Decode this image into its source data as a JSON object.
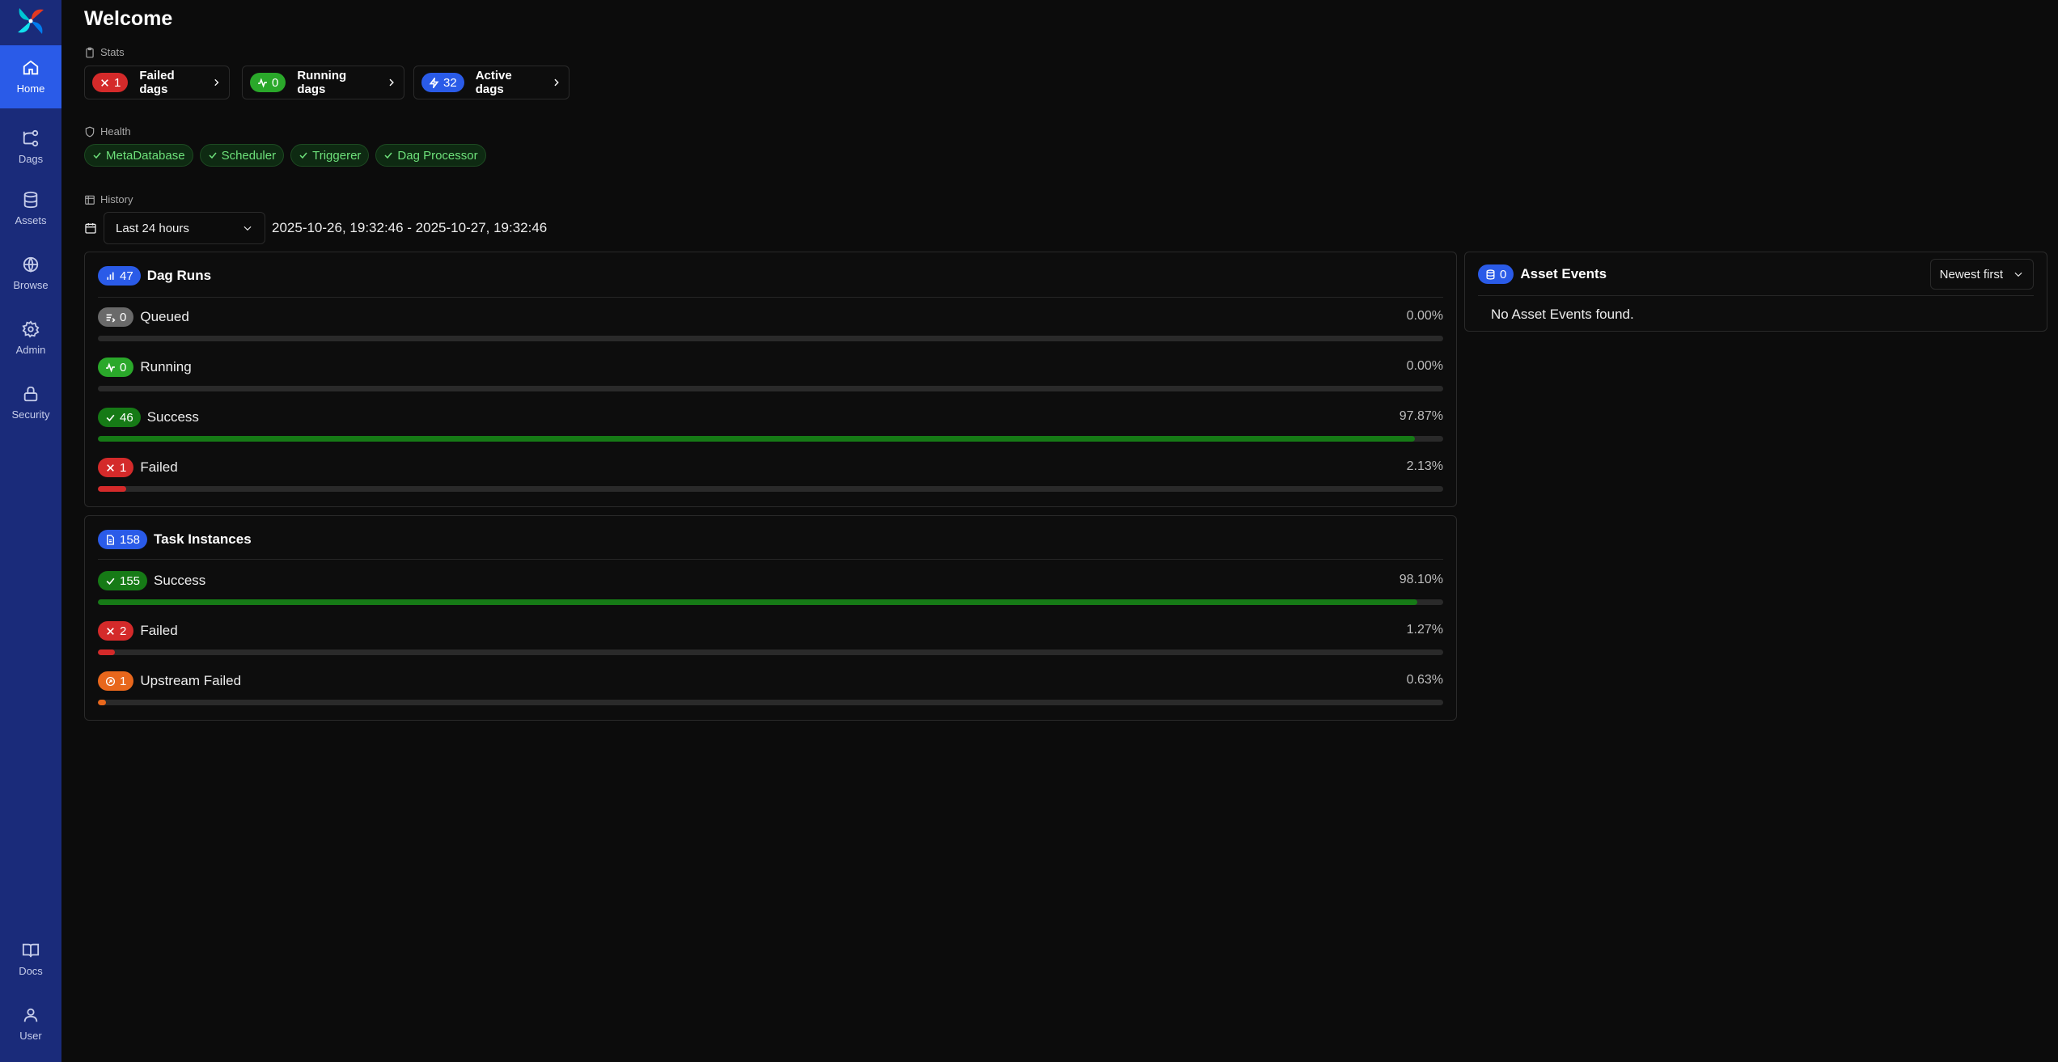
{
  "sidebar": {
    "items": [
      {
        "label": "Home",
        "icon": "home-icon",
        "active": true
      },
      {
        "label": "Dags",
        "icon": "dags-icon"
      },
      {
        "label": "Assets",
        "icon": "database-icon"
      },
      {
        "label": "Browse",
        "icon": "globe-icon"
      },
      {
        "label": "Admin",
        "icon": "gear-icon"
      },
      {
        "label": "Security",
        "icon": "lock-icon"
      },
      {
        "label": "Docs",
        "icon": "book-icon"
      },
      {
        "label": "User",
        "icon": "user-icon"
      }
    ]
  },
  "page": {
    "title": "Welcome"
  },
  "stats": {
    "section_label": "Stats",
    "cards": [
      {
        "count": "1",
        "label": "Failed dags",
        "color": "#d42a2a"
      },
      {
        "count": "0",
        "label": "Running dags",
        "color": "#2aa82a"
      },
      {
        "count": "32",
        "label": "Active dags",
        "color": "#2a5be8"
      }
    ]
  },
  "health": {
    "section_label": "Health",
    "items": [
      "MetaDatabase",
      "Scheduler",
      "Triggerer",
      "Dag Processor"
    ]
  },
  "history": {
    "section_label": "History",
    "range_select": "Last 24 hours",
    "date_range": "2025-10-26, 19:32:46 - 2025-10-27, 19:32:46"
  },
  "dag_runs": {
    "count": "47",
    "title": "Dag Runs",
    "rows": [
      {
        "count": "0",
        "label": "Queued",
        "pct": "0.00%",
        "fraction": 0.0,
        "color": "#6a6a6a"
      },
      {
        "count": "0",
        "label": "Running",
        "pct": "0.00%",
        "fraction": 0.0,
        "color": "#2aa82a"
      },
      {
        "count": "46",
        "label": "Success",
        "pct": "97.87%",
        "fraction": 0.9787,
        "color": "#167a16"
      },
      {
        "count": "1",
        "label": "Failed",
        "pct": "2.13%",
        "fraction": 0.0213,
        "color": "#d42a2a"
      }
    ]
  },
  "task_instances": {
    "count": "158",
    "title": "Task Instances",
    "rows": [
      {
        "count": "155",
        "label": "Success",
        "pct": "98.10%",
        "fraction": 0.981,
        "color": "#167a16"
      },
      {
        "count": "2",
        "label": "Failed",
        "pct": "1.27%",
        "fraction": 0.0127,
        "color": "#d42a2a"
      },
      {
        "count": "1",
        "label": "Upstream Failed",
        "pct": "0.63%",
        "fraction": 0.0063,
        "color": "#e8671c"
      }
    ]
  },
  "asset_events": {
    "count": "0",
    "title": "Asset Events",
    "sort_select": "Newest first",
    "empty_text": "No Asset Events found."
  }
}
